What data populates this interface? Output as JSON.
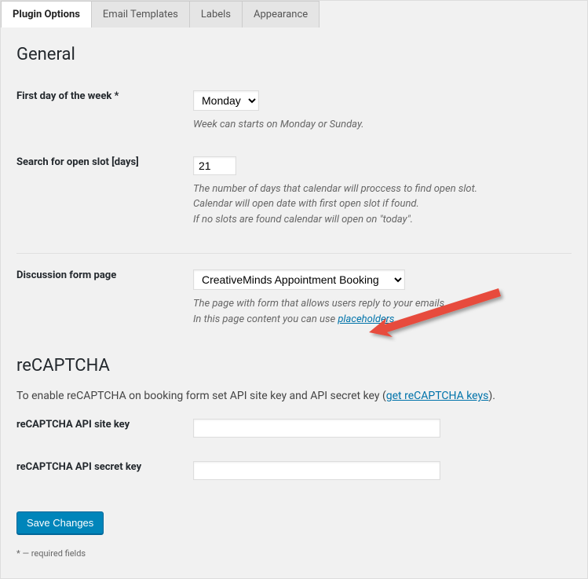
{
  "tabs": {
    "pluginOptions": "Plugin Options",
    "emailTemplates": "Email Templates",
    "labels": "Labels",
    "appearance": "Appearance"
  },
  "sections": {
    "general": "General",
    "recaptcha": "reCAPTCHA"
  },
  "fields": {
    "firstDay": {
      "label": "First day of the week *",
      "value": "Monday",
      "desc": "Week can starts on Monday or Sunday."
    },
    "searchDays": {
      "label": "Search for open slot [days]",
      "value": "21",
      "desc1": "The number of days that calendar will proccess to find open slot.",
      "desc2": "Calendar will open date with first open slot if found.",
      "desc3": "If no slots are found calendar will open on \"today\"."
    },
    "discussionPage": {
      "label": "Discussion form page",
      "value": "CreativeMinds Appointment Booking",
      "desc1": "The page with form that allows users reply to your emails.",
      "desc2a": "In this page content you can use ",
      "desc2link": "placeholders",
      "desc2b": "."
    },
    "recaptchaText": {
      "pre": "To enable reCAPTCHA on booking form set API site key and API secret key (",
      "link": "get reCAPTCHA keys",
      "post": ")."
    },
    "siteKey": {
      "label": "reCAPTCHA API site key",
      "value": ""
    },
    "secretKey": {
      "label": "reCAPTCHA API secret key",
      "value": ""
    }
  },
  "saveButton": "Save Changes",
  "footnote": "* — required fields"
}
